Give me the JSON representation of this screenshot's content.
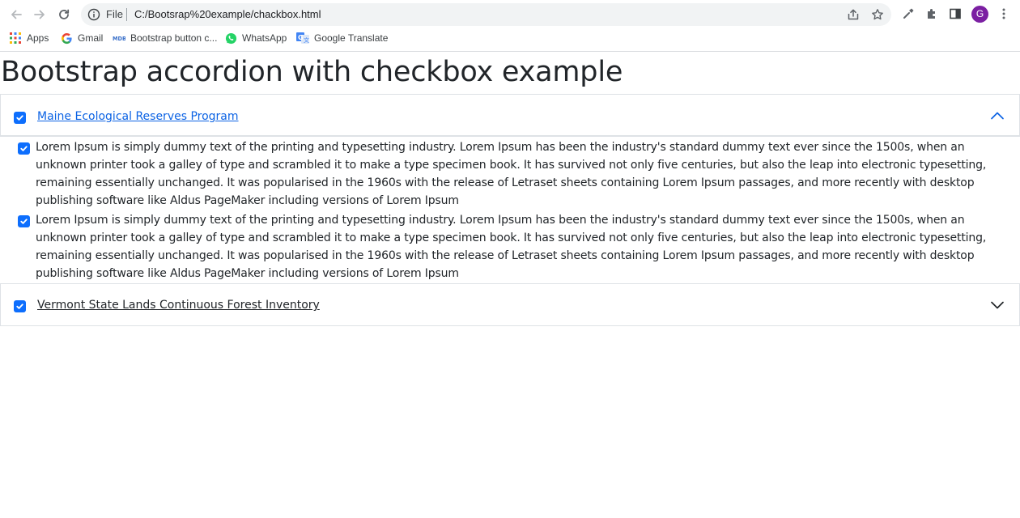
{
  "browser": {
    "address": {
      "scheme_label": "File",
      "url": "C:/Bootsrap%20example/chackbox.html"
    },
    "profile_initial": "G",
    "bookmarks": [
      {
        "label": "Apps",
        "icon": "apps-grid-icon"
      },
      {
        "label": "Gmail",
        "icon": "google-g-icon"
      },
      {
        "label": "Bootstrap button c...",
        "icon": "mdb-icon"
      },
      {
        "label": "WhatsApp",
        "icon": "whatsapp-icon"
      },
      {
        "label": "Google Translate",
        "icon": "google-translate-icon"
      }
    ],
    "toolbar_icons": [
      "back-icon",
      "forward-icon",
      "reload-icon",
      "share-icon",
      "star-icon",
      "eyedropper-icon",
      "extensions-icon",
      "side-panel-icon",
      "menu-icon"
    ]
  },
  "page": {
    "title": "Bootstrap accordion with checkbox example",
    "accordion": [
      {
        "label": "Maine Ecological Reserves Program",
        "checked": true,
        "expanded": true,
        "items": [
          {
            "checked": true,
            "text": "Lorem Ipsum is simply dummy text of the printing and typesetting industry. Lorem Ipsum has been the industry's standard dummy text ever since the 1500s, when an unknown printer took a galley of type and scrambled it to make a type specimen book. It has survived not only five centuries, but also the leap into electronic typesetting, remaining essentially unchanged. It was popularised in the 1960s with the release of Letraset sheets containing Lorem Ipsum passages, and more recently with desktop publishing software like Aldus PageMaker including versions of Lorem Ipsum"
          },
          {
            "checked": true,
            "text": "Lorem Ipsum is simply dummy text of the printing and typesetting industry. Lorem Ipsum has been the industry's standard dummy text ever since the 1500s, when an unknown printer took a galley of type and scrambled it to make a type specimen book. It has survived not only five centuries, but also the leap into electronic typesetting, remaining essentially unchanged. It was popularised in the 1960s with the release of Letraset sheets containing Lorem Ipsum passages, and more recently with desktop publishing software like Aldus PageMaker including versions of Lorem Ipsum"
          }
        ]
      },
      {
        "label": "Vermont State Lands Continuous Forest Inventory",
        "checked": true,
        "expanded": false,
        "items": []
      }
    ]
  },
  "colors": {
    "primary": "#0d6efd",
    "link_active": "#0c63e4",
    "text": "#212529",
    "border": "#dee2e6",
    "avatar": "#7b1fa2"
  }
}
